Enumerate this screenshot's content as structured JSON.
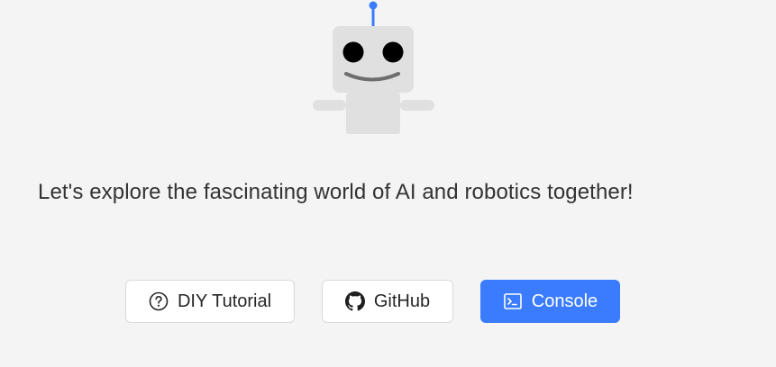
{
  "hero": {
    "mascot_icon": "robot-icon",
    "tagline": "Let's explore the fascinating world of AI and robotics together!"
  },
  "actions": {
    "diy_tutorial": {
      "label": "DIY Tutorial",
      "icon": "question-circle-icon"
    },
    "github": {
      "label": "GitHub",
      "icon": "github-icon"
    },
    "console": {
      "label": "Console",
      "icon": "terminal-icon"
    }
  },
  "colors": {
    "background": "#f4f4f4",
    "primary": "#3b7cff",
    "robot_body": "#e0e0e0",
    "robot_antenna": "#3b7cff"
  }
}
